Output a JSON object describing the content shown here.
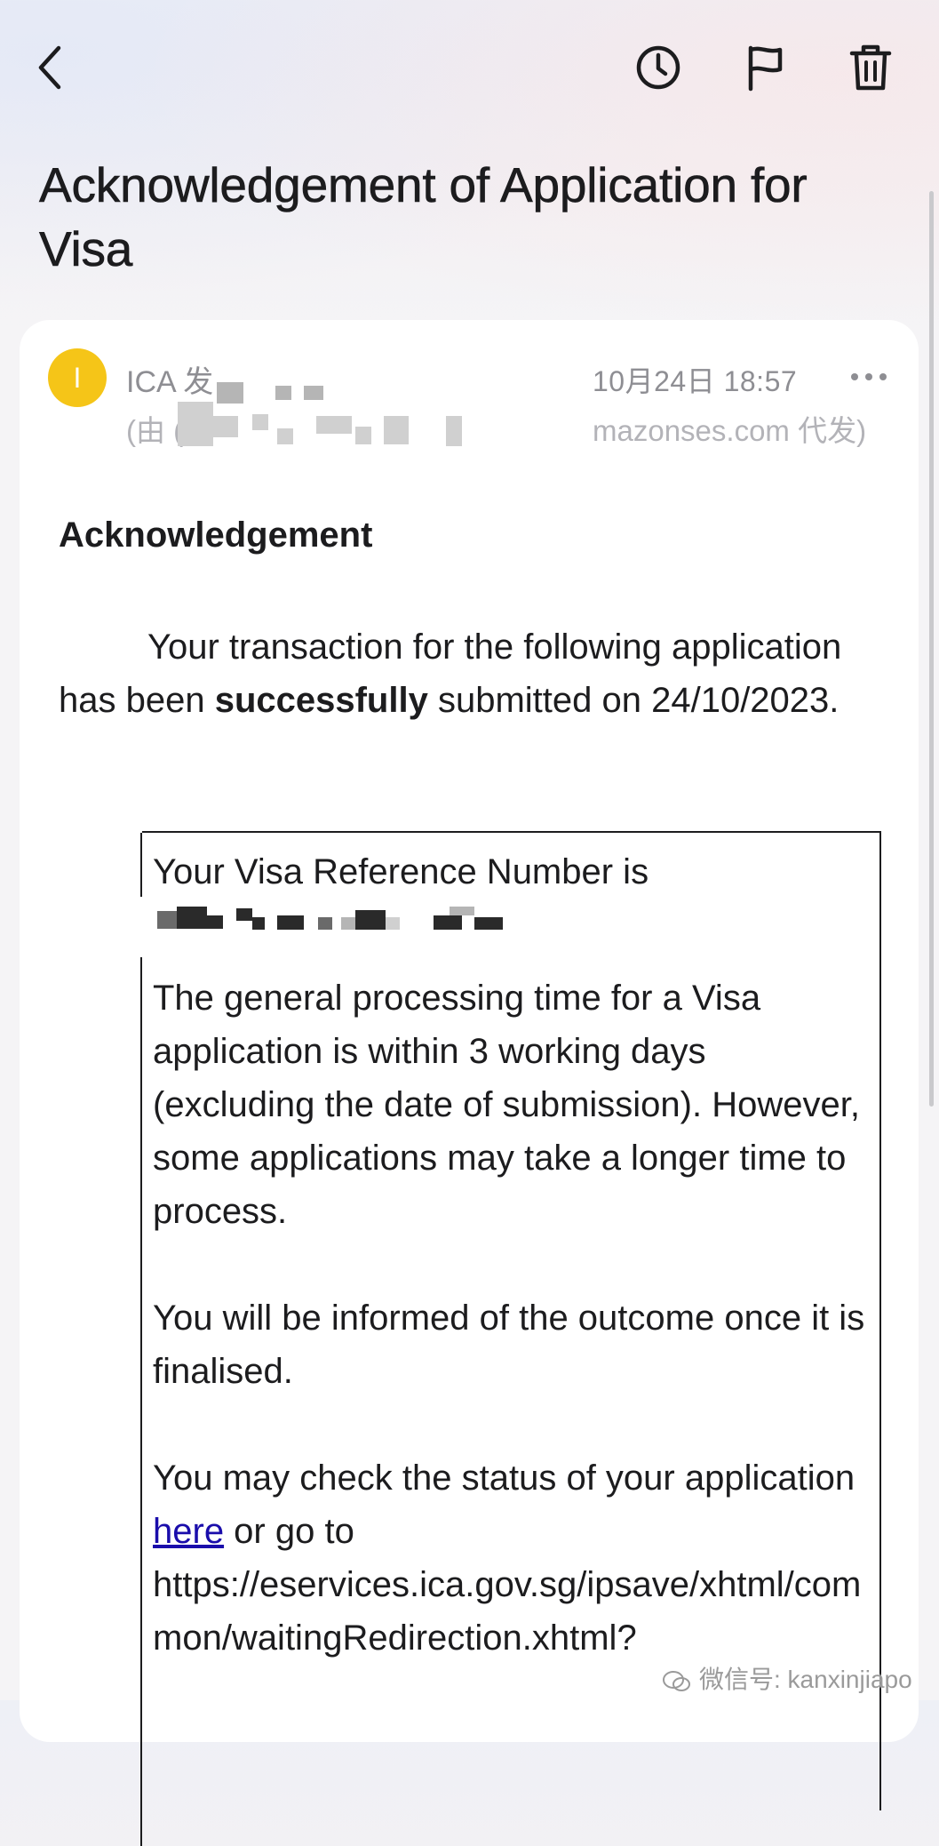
{
  "toolbar": {
    "back_icon": "chevron-left-icon",
    "snooze_icon": "clock-icon",
    "flag_icon": "flag-icon",
    "delete_icon": "trash-icon"
  },
  "email": {
    "subject": "Acknowledgement of Application for Visa",
    "sender": {
      "avatar_letter": "I",
      "avatar_color": "#f5c518",
      "name": "ICA 发",
      "via_prefix": "(由 (",
      "via_domain": "mazonses.com 代发)"
    },
    "date": "10月24日 18:57",
    "more_label": "•••",
    "heading": "Acknowledgement",
    "intro": {
      "part1": "Your transaction for the following application has been ",
      "bold": "successfully",
      "part2": " submitted on 24/10/2023."
    },
    "box": {
      "reference_line": "Your Visa Reference Number is",
      "processing": "The general processing time for a Visa application is within 3 working days (excluding the date of submission). However, some applications may take a longer time to process.",
      "outcome": "You will be informed of the outcome once it is finalised.",
      "status_prefix": "You may check the status of your application ",
      "status_link": "here",
      "status_suffix": " or go to",
      "status_url": "https://eservices.ica.gov.sg/ipsave/xhtml/common/waitingRedirection.xhtml?"
    }
  },
  "watermark": "微信号: kanxinjiapo"
}
